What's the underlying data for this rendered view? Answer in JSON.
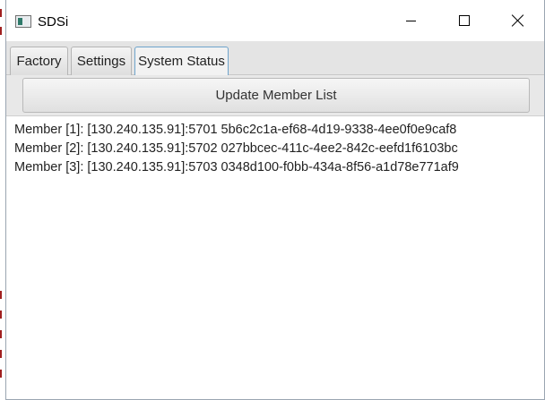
{
  "window": {
    "title": "SDSi",
    "icon": "app-window-icon",
    "controls": {
      "minimize_icon": "minimize-icon",
      "maximize_icon": "maximize-icon",
      "close_icon": "close-icon"
    }
  },
  "tabs": [
    {
      "label": "Factory",
      "active": false
    },
    {
      "label": "Settings",
      "active": false
    },
    {
      "label": "System Status",
      "active": true
    }
  ],
  "toolbar": {
    "update_label": "Update Member List"
  },
  "members": [
    "Member [1]: [130.240.135.91]:5701 5b6c2c1a-ef68-4d19-9338-4ee0f0e9caf8",
    "Member [2]: [130.240.135.91]:5702 027bbcec-411c-4ee2-842c-eefd1f6103bc",
    "Member [3]: [130.240.135.91]:5703 0348d100-f0bb-434a-8f56-a1d78e771af9"
  ],
  "colors": {
    "active_tab_border": "#6fa4cc",
    "background_text_marks": "#a02020"
  }
}
